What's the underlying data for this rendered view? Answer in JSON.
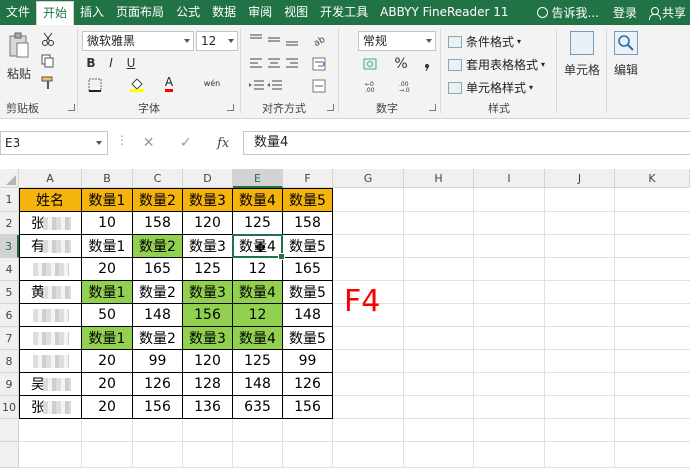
{
  "tabs": [
    {
      "label": "文件",
      "active": false
    },
    {
      "label": "开始",
      "active": true
    },
    {
      "label": "插入",
      "active": false
    },
    {
      "label": "页面布局",
      "active": false
    },
    {
      "label": "公式",
      "active": false
    },
    {
      "label": "数据",
      "active": false
    },
    {
      "label": "审阅",
      "active": false
    },
    {
      "label": "视图",
      "active": false
    },
    {
      "label": "开发工具",
      "active": false
    },
    {
      "label": "ABBYY FineReader 11",
      "active": false
    }
  ],
  "tellme": "告诉我...",
  "login": "登录",
  "share": "共享",
  "ribbon": {
    "clipboard": {
      "label": "剪贴板",
      "paste": "粘贴"
    },
    "font": {
      "label": "字体",
      "name": "微软雅黑",
      "size": "12",
      "bold": "B",
      "italic": "I",
      "underline": "U",
      "color": "A",
      "phonetic": "wén"
    },
    "alignment": {
      "label": "对齐方式"
    },
    "number": {
      "label": "数字",
      "format": "常规",
      "percent": "%"
    },
    "styles": {
      "label": "样式",
      "conditional": "条件格式",
      "table_format": "套用表格格式",
      "cell_style": "单元格样式"
    },
    "cells": {
      "label": "单元格"
    },
    "editing": {
      "label": "编辑"
    }
  },
  "formula_bar": {
    "name_box": "E3",
    "formula": "数量4",
    "fx": "fx"
  },
  "columns": [
    "A",
    "B",
    "C",
    "D",
    "E",
    "F",
    "G",
    "H",
    "I",
    "J",
    "K"
  ],
  "rows": [
    "1",
    "2",
    "3",
    "4",
    "5",
    "6",
    "7",
    "8",
    "9",
    "10"
  ],
  "table": [
    [
      "姓名",
      "数量1",
      "数量2",
      "数量3",
      "数量4",
      "数量5"
    ],
    [
      "张**",
      "10",
      "158",
      "120",
      "125",
      "158"
    ],
    [
      "",
      "数量1",
      "数量2",
      "数量3",
      "数量4",
      "数量5"
    ],
    [
      "黄**",
      "20",
      "165",
      "125",
      "12",
      "165"
    ],
    [
      "",
      "数量1",
      "数量2",
      "数量3",
      "数量4",
      "数量5"
    ],
    [
      "",
      "50",
      "148",
      "156",
      "12",
      "148"
    ],
    [
      "",
      "数量1",
      "数量2",
      "数量3",
      "数量4",
      "数量5"
    ],
    [
      "吴**亭",
      "20",
      "99",
      "120",
      "125",
      "99"
    ],
    [
      "张**",
      "20",
      "126",
      "128",
      "148",
      "126"
    ],
    [
      "",
      "20",
      "156",
      "136",
      "635",
      "156"
    ]
  ],
  "visible_names": [
    "张",
    "有",
    "",
    "黄",
    "",
    "",
    "",
    "吴",
    "张",
    "庄"
  ],
  "cell_colors": {
    "header": "#f5b30e",
    "green": "#92d050",
    "selection": "#217346"
  },
  "green_cells": [
    [
      2,
      2
    ],
    [
      4,
      1
    ],
    [
      4,
      3
    ],
    [
      4,
      4
    ],
    [
      5,
      3
    ],
    [
      5,
      4
    ],
    [
      6,
      1
    ],
    [
      6,
      3
    ],
    [
      6,
      4
    ]
  ],
  "active_cell": "E3",
  "key_hint": "F4"
}
